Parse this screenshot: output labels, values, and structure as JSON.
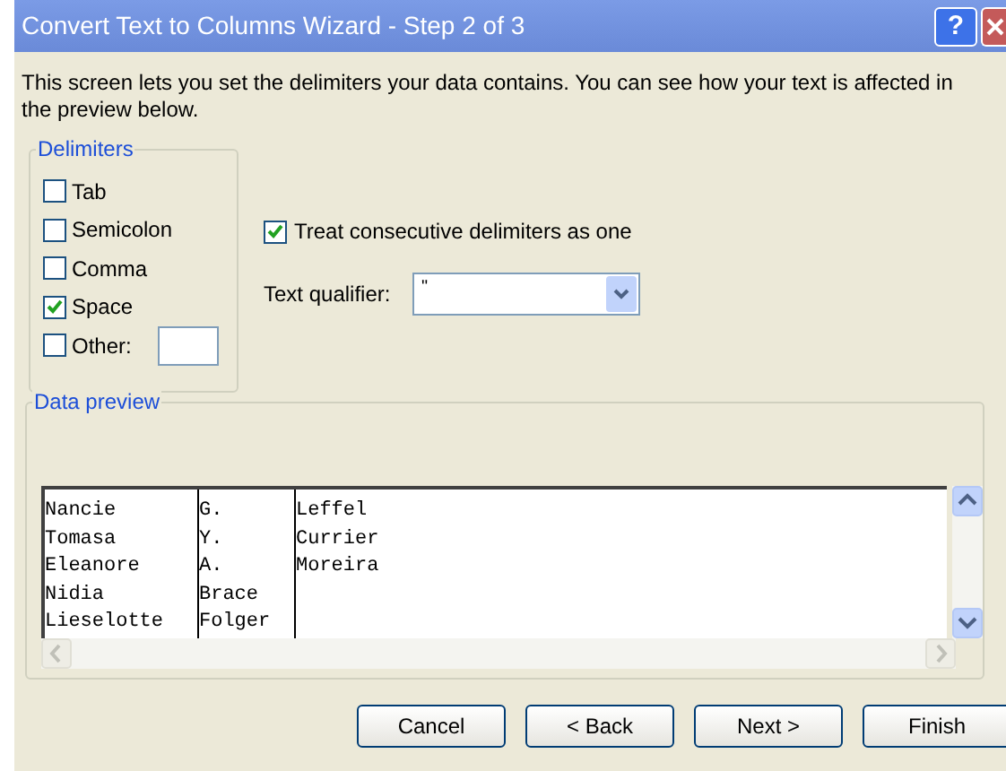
{
  "window": {
    "title": "Convert Text to Columns Wizard - Step 2 of 3",
    "help_button": "?"
  },
  "description": "This screen lets you set the delimiters your data contains.  You can see how your text is affected in the preview below.",
  "delimiters": {
    "legend": "Delimiters",
    "options": [
      {
        "label": "Tab",
        "checked": false
      },
      {
        "label": "Semicolon",
        "checked": false
      },
      {
        "label": "Comma",
        "checked": false
      },
      {
        "label": "Space",
        "checked": true
      },
      {
        "label": "Other:",
        "checked": false,
        "kind": "other"
      }
    ]
  },
  "treat_consecutive": {
    "label": "Treat consecutive delimiters as one",
    "checked": true
  },
  "text_qualifier": {
    "label": "Text qualifier:",
    "value": "\""
  },
  "data_preview": {
    "legend": "Data preview",
    "rows": [
      [
        "Nancie",
        "G.",
        "Leffel"
      ],
      [
        "Tomasa",
        "Y.",
        "Currier"
      ],
      [
        "Eleanore",
        "A.",
        "Moreira"
      ],
      [
        "Nidia",
        "Brace"
      ],
      [
        "Lieselotte",
        "Folger"
      ]
    ]
  },
  "buttons": [
    "Cancel",
    "< Back",
    "Next >",
    "Finish"
  ]
}
